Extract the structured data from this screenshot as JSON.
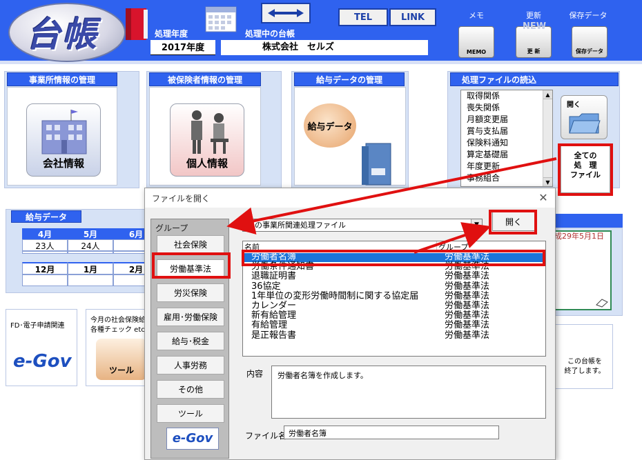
{
  "header": {
    "logo": "台帳",
    "fiscal_year_label": "処理年度",
    "fiscal_year_value": "2017年度",
    "ledger_label": "処理中の台帳",
    "ledger_value": "株式会社　セルズ",
    "tel_button": "TEL",
    "link_button": "LINK",
    "memo_caption": "メモ",
    "memo_icon_text": "MEMO",
    "update_caption": "更新",
    "update_icon_new": "NEW",
    "update_icon_text": "更 新",
    "save_caption": "保存データ",
    "save_icon_text": "保存データ"
  },
  "panels": {
    "office": {
      "title": "事業所情報の管理",
      "button": "会社情報"
    },
    "insured": {
      "title": "被保険者情報の管理",
      "button": "個人情報"
    },
    "salary": {
      "title": "給与データの管理",
      "button": "給与データ"
    },
    "file_load": {
      "title": "処理ファイルの読込",
      "items": [
        "取得関係",
        "喪失関係",
        "月額変更届",
        "賞与支払届",
        "保険料通知",
        "算定基礎届",
        "年度更新",
        "事務組合"
      ],
      "open_label": "開く",
      "all_files_button": "全ての\n処　理\nファイル"
    }
  },
  "salary_data": {
    "title": "給与データ",
    "months_top": [
      "4月",
      "5月",
      "6月"
    ],
    "counts_top": [
      "23人",
      "24人",
      ""
    ],
    "months_bottom": [
      "12月",
      "1月",
      "2月"
    ]
  },
  "bottom": {
    "fd_title": "FD･電子申請関連",
    "monthly_line1": "今月の社会保険給",
    "monthly_line2": "各種チェック etc",
    "tool_label": "ツール",
    "exit_line1": "この台帳を",
    "exit_line2": "終了します。",
    "date_fragment": "成29年5月1日"
  },
  "dialog": {
    "title": "ファイルを開く",
    "close": "✕",
    "group_label": "グループ",
    "groups": [
      "社会保険",
      "労働基準法",
      "労災保険",
      "雇用･労働保険",
      "給与･税金",
      "人事労務",
      "その他",
      "ツール"
    ],
    "combo_value": "この事業所関連処理ファイル",
    "open_button": "開く",
    "columns": [
      "名前",
      "グループ"
    ],
    "rows": [
      {
        "name": "労働者名簿",
        "group": "労働基準法"
      },
      {
        "name": "労働条件通知書",
        "group": "労働基準法"
      },
      {
        "name": "退職証明書",
        "group": "労働基準法"
      },
      {
        "name": "36協定",
        "group": "労働基準法"
      },
      {
        "name": "1年単位の変形労働時間制に関する協定届",
        "group": "労働基準法"
      },
      {
        "name": "カレンダー",
        "group": "労働基準法"
      },
      {
        "name": "新有給管理",
        "group": "労働基準法"
      },
      {
        "name": "有給管理",
        "group": "労働基準法"
      },
      {
        "name": "是正報告書",
        "group": "労働基準法"
      }
    ],
    "content_label": "内容",
    "content_value": "労働者名簿を作成します。",
    "filename_label": "ファイル名",
    "filename_value": "労働者名簿",
    "egov_logo": "e-Gov"
  },
  "colors": {
    "header_blue": "#2f62ef",
    "panel_bg": "#d6e2f6",
    "selection": "#1d74d8",
    "annotation_red": "#e01010"
  }
}
